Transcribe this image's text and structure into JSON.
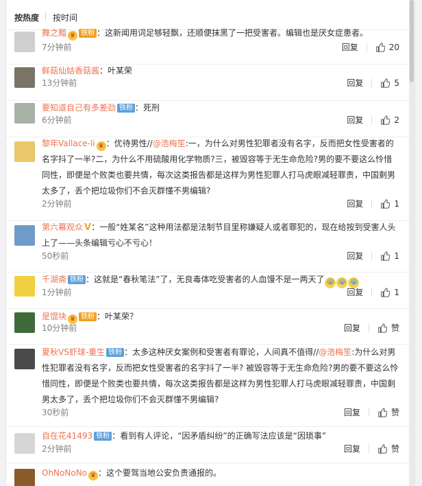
{
  "sort": {
    "hot": "按热度",
    "time": "按时间"
  },
  "reply_label": "回复",
  "comments": [
    {
      "user": "舞之黯",
      "badge": "铁粉",
      "badge_style": "gold",
      "vip": true,
      "text": "：这新闻用词足够轻飘，还顺便抹黑了一把受害者。编辑也是厌女症患者。",
      "time": "7分钟前",
      "likes": "20",
      "avatar_color": "#cfcfcf"
    },
    {
      "user": "鲜菇仙姑香菇酱",
      "text": "：叶某荣",
      "time": "13分钟前",
      "likes": "5",
      "avatar_color": "#7a7466"
    },
    {
      "user": "要知道自己有多差劲",
      "badge": "铁粉",
      "text": "：死刑",
      "time": "6分钟前",
      "likes": "2",
      "avatar_color": "#a8b3a8"
    },
    {
      "user": "黎年Vallace-li",
      "vip": true,
      "text_parts": [
        "：优待男性//",
        "@浩梅笙",
        ":一，为什么对男性犯罪者没有名字，反而把女性受害者的名字抖了一半?二，为什么不用硫酸用化学物质?三，被毁容等于无生命危险?男的要不要这么怜惜同性，即便是个败类也要共情，每次这类报告都是这样为男性犯罪人打马虎眼减轻罪责，中国剩男太多了，丢个把垃圾你们不会灭群懂不男编辑?"
      ],
      "time": "2分钟前",
      "likes": "1",
      "avatar_color": "#e8c86a"
    },
    {
      "user": "第六幕观众",
      "vbig": "V",
      "text": "：一般“姓某名”这种用法都是法制节目里称嫌疑人或者罪犯的，现在给按到受害人头上了——头条编辑亏心不亏心！",
      "time": "50秒前",
      "likes": "1",
      "avatar_color": "#6f9bc9"
    },
    {
      "user": "千湖斋",
      "badge": "铁粉",
      "text": "：这就是“春秋笔法”了，无良毒体吃受害者的人血馒不是一两天了",
      "emojis": 3,
      "time": "1分钟前",
      "likes": "1",
      "avatar_color": "#f0d040"
    },
    {
      "user": "是馄块",
      "badge": "铁粉",
      "badge_style": "gold",
      "vip": true,
      "text": "：叶某荣？",
      "time": "10分钟前",
      "likes": "赞",
      "avatar_color": "#3f6b3a"
    },
    {
      "user": "夏秋VS虾球-重生",
      "badge": "铁粉",
      "text_parts": [
        "：太多这种厌女案例和受害者有罪论，人间真不值得//",
        "@浩梅笙",
        ":为什么对男性犯罪者没有名字，反而把女性受害者的名字抖了一半? 被毁容等于无生命危险?男的要不要这么怜惜同性，即便是个败类也要共情，每次这类报告都是这样为男性犯罪人打马虎眼减轻罪责，中国剩男太多了，丢个把垃圾你们不会灭群懂不男编辑?"
      ],
      "time": "30秒前",
      "likes": "赞",
      "avatar_color": "#4a4a4a"
    },
    {
      "user": "自在花41493",
      "badge": "铁粉",
      "text": "：看到有人评论，“因矛盾纠纷”的正确写法应该是“因琐事”",
      "time": "2分钟前",
      "likes": "赞",
      "avatar_color": "#d6d6d6"
    },
    {
      "user": "OhNoNoNo",
      "vip": true,
      "text": "：这个要驾当地公安负责通报的。",
      "time": "",
      "likes": "",
      "avatar_color": "#8b5a2b"
    }
  ]
}
